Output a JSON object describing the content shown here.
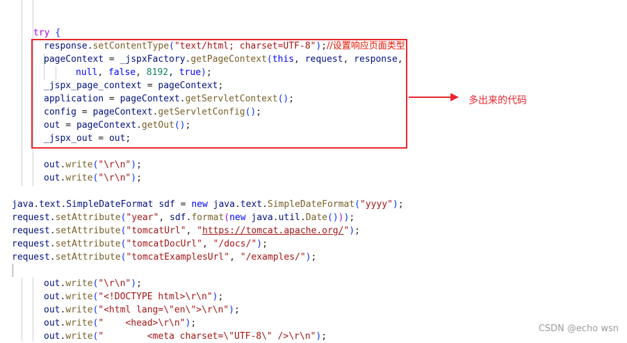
{
  "annotation": {
    "label": "多出来的代码",
    "color": "#e8262c"
  },
  "watermark": "CSDN @echo wsn",
  "theme": {
    "keyword": "#0000ff",
    "control": "#af00db",
    "variable": "#001080",
    "function": "#795e26",
    "string": "#a31515",
    "number": "#098658"
  },
  "code": {
    "lines": [
      [
        {
          "t": "try",
          "c": "ctl"
        },
        {
          "t": " ",
          "c": "plain"
        },
        {
          "t": "{",
          "c": "brk"
        }
      ],
      [
        {
          "t": "response",
          "c": "var"
        },
        {
          "t": ".",
          "c": "plain"
        },
        {
          "t": "setContentType",
          "c": "fn"
        },
        {
          "t": "(",
          "c": "brk"
        },
        {
          "t": "\"text/html; charset=UTF-8\"",
          "c": "str"
        },
        {
          "t": ")",
          "c": "brk"
        },
        {
          "t": ";",
          "c": "plain"
        },
        {
          "t": "//设置响应页面类型",
          "c": "cn"
        }
      ],
      [
        {
          "t": "pageContext",
          "c": "var"
        },
        {
          "t": " = ",
          "c": "plain"
        },
        {
          "t": "_jspxFactory",
          "c": "var"
        },
        {
          "t": ".",
          "c": "plain"
        },
        {
          "t": "getPageContext",
          "c": "fn"
        },
        {
          "t": "(",
          "c": "brk"
        },
        {
          "t": "this",
          "c": "kw"
        },
        {
          "t": ", ",
          "c": "plain"
        },
        {
          "t": "request",
          "c": "var"
        },
        {
          "t": ", ",
          "c": "plain"
        },
        {
          "t": "response",
          "c": "var"
        },
        {
          "t": ",",
          "c": "plain"
        }
      ],
      [
        {
          "t": "null",
          "c": "kw"
        },
        {
          "t": ", ",
          "c": "plain"
        },
        {
          "t": "false",
          "c": "kw"
        },
        {
          "t": ", ",
          "c": "plain"
        },
        {
          "t": "8192",
          "c": "num"
        },
        {
          "t": ", ",
          "c": "plain"
        },
        {
          "t": "true",
          "c": "kw"
        },
        {
          "t": ")",
          "c": "brk"
        },
        {
          "t": ";",
          "c": "plain"
        }
      ],
      [
        {
          "t": "_jspx_page_context",
          "c": "var"
        },
        {
          "t": " = ",
          "c": "plain"
        },
        {
          "t": "pageContext",
          "c": "var"
        },
        {
          "t": ";",
          "c": "plain"
        }
      ],
      [
        {
          "t": "application",
          "c": "var"
        },
        {
          "t": " = ",
          "c": "plain"
        },
        {
          "t": "pageContext",
          "c": "var"
        },
        {
          "t": ".",
          "c": "plain"
        },
        {
          "t": "getServletContext",
          "c": "fn"
        },
        {
          "t": "()",
          "c": "brk"
        },
        {
          "t": ";",
          "c": "plain"
        }
      ],
      [
        {
          "t": "config",
          "c": "var"
        },
        {
          "t": " = ",
          "c": "plain"
        },
        {
          "t": "pageContext",
          "c": "var"
        },
        {
          "t": ".",
          "c": "plain"
        },
        {
          "t": "getServletConfig",
          "c": "fn"
        },
        {
          "t": "()",
          "c": "brk"
        },
        {
          "t": ";",
          "c": "plain"
        }
      ],
      [
        {
          "t": "out",
          "c": "var"
        },
        {
          "t": " = ",
          "c": "plain"
        },
        {
          "t": "pageContext",
          "c": "var"
        },
        {
          "t": ".",
          "c": "plain"
        },
        {
          "t": "getOut",
          "c": "fn"
        },
        {
          "t": "()",
          "c": "brk"
        },
        {
          "t": ";",
          "c": "plain"
        }
      ],
      [
        {
          "t": "_jspx_out",
          "c": "var"
        },
        {
          "t": " = ",
          "c": "plain"
        },
        {
          "t": "out",
          "c": "var"
        },
        {
          "t": ";",
          "c": "plain"
        }
      ],
      [],
      [
        {
          "t": "out",
          "c": "var"
        },
        {
          "t": ".",
          "c": "plain"
        },
        {
          "t": "write",
          "c": "fn"
        },
        {
          "t": "(",
          "c": "brk"
        },
        {
          "t": "\"\\r\\n\"",
          "c": "str"
        },
        {
          "t": ")",
          "c": "brk"
        },
        {
          "t": ";",
          "c": "plain"
        }
      ],
      [
        {
          "t": "out",
          "c": "var"
        },
        {
          "t": ".",
          "c": "plain"
        },
        {
          "t": "write",
          "c": "fn"
        },
        {
          "t": "(",
          "c": "brk"
        },
        {
          "t": "\"\\r\\n\"",
          "c": "str"
        },
        {
          "t": ")",
          "c": "brk"
        },
        {
          "t": ";",
          "c": "plain"
        }
      ],
      [],
      [
        {
          "t": "java",
          "c": "var"
        },
        {
          "t": ".",
          "c": "plain"
        },
        {
          "t": "text",
          "c": "var"
        },
        {
          "t": ".",
          "c": "plain"
        },
        {
          "t": "SimpleDateFormat",
          "c": "var"
        },
        {
          "t": " ",
          "c": "plain"
        },
        {
          "t": "sdf",
          "c": "var"
        },
        {
          "t": " = ",
          "c": "plain"
        },
        {
          "t": "new",
          "c": "kw"
        },
        {
          "t": " ",
          "c": "plain"
        },
        {
          "t": "java",
          "c": "var"
        },
        {
          "t": ".",
          "c": "plain"
        },
        {
          "t": "text",
          "c": "var"
        },
        {
          "t": ".",
          "c": "plain"
        },
        {
          "t": "SimpleDateFormat",
          "c": "fn"
        },
        {
          "t": "(",
          "c": "brk"
        },
        {
          "t": "\"yyyy\"",
          "c": "str"
        },
        {
          "t": ")",
          "c": "brk"
        },
        {
          "t": ";",
          "c": "plain"
        }
      ],
      [
        {
          "t": "request",
          "c": "var"
        },
        {
          "t": ".",
          "c": "plain"
        },
        {
          "t": "setAttribute",
          "c": "fn"
        },
        {
          "t": "(",
          "c": "brk"
        },
        {
          "t": "\"year\"",
          "c": "str"
        },
        {
          "t": ", ",
          "c": "plain"
        },
        {
          "t": "sdf",
          "c": "var"
        },
        {
          "t": ".",
          "c": "plain"
        },
        {
          "t": "format",
          "c": "fn"
        },
        {
          "t": "(",
          "c": "ctl"
        },
        {
          "t": "new",
          "c": "kw"
        },
        {
          "t": " ",
          "c": "plain"
        },
        {
          "t": "java",
          "c": "var"
        },
        {
          "t": ".",
          "c": "plain"
        },
        {
          "t": "util",
          "c": "var"
        },
        {
          "t": ".",
          "c": "plain"
        },
        {
          "t": "Date",
          "c": "fn"
        },
        {
          "t": "()",
          "c": "brk"
        },
        {
          "t": ")",
          "c": "ctl"
        },
        {
          "t": ")",
          "c": "brk"
        },
        {
          "t": ";",
          "c": "plain"
        }
      ],
      [
        {
          "t": "request",
          "c": "var"
        },
        {
          "t": ".",
          "c": "plain"
        },
        {
          "t": "setAttribute",
          "c": "fn"
        },
        {
          "t": "(",
          "c": "brk"
        },
        {
          "t": "\"tomcatUrl\"",
          "c": "str"
        },
        {
          "t": ", ",
          "c": "plain"
        },
        {
          "t": "\"",
          "c": "str"
        },
        {
          "t": "https://tomcat.apache.org/",
          "c": "url"
        },
        {
          "t": "\"",
          "c": "str"
        },
        {
          "t": ")",
          "c": "brk"
        },
        {
          "t": ";",
          "c": "plain"
        }
      ],
      [
        {
          "t": "request",
          "c": "var"
        },
        {
          "t": ".",
          "c": "plain"
        },
        {
          "t": "setAttribute",
          "c": "fn"
        },
        {
          "t": "(",
          "c": "brk"
        },
        {
          "t": "\"tomcatDocUrl\"",
          "c": "str"
        },
        {
          "t": ", ",
          "c": "plain"
        },
        {
          "t": "\"/docs/\"",
          "c": "str"
        },
        {
          "t": ")",
          "c": "brk"
        },
        {
          "t": ";",
          "c": "plain"
        }
      ],
      [
        {
          "t": "request",
          "c": "var"
        },
        {
          "t": ".",
          "c": "plain"
        },
        {
          "t": "setAttribute",
          "c": "fn"
        },
        {
          "t": "(",
          "c": "brk"
        },
        {
          "t": "\"tomcatExamplesUrl\"",
          "c": "str"
        },
        {
          "t": ", ",
          "c": "plain"
        },
        {
          "t": "\"/examples/\"",
          "c": "str"
        },
        {
          "t": ")",
          "c": "brk"
        },
        {
          "t": ";",
          "c": "plain"
        }
      ],
      [],
      [
        {
          "t": "out",
          "c": "var"
        },
        {
          "t": ".",
          "c": "plain"
        },
        {
          "t": "write",
          "c": "fn"
        },
        {
          "t": "(",
          "c": "brk"
        },
        {
          "t": "\"\\r\\n\"",
          "c": "str"
        },
        {
          "t": ")",
          "c": "brk"
        },
        {
          "t": ";",
          "c": "plain"
        }
      ],
      [
        {
          "t": "out",
          "c": "var"
        },
        {
          "t": ".",
          "c": "plain"
        },
        {
          "t": "write",
          "c": "fn"
        },
        {
          "t": "(",
          "c": "brk"
        },
        {
          "t": "\"<!DOCTYPE html>\\r\\n\"",
          "c": "str"
        },
        {
          "t": ")",
          "c": "brk"
        },
        {
          "t": ";",
          "c": "plain"
        }
      ],
      [
        {
          "t": "out",
          "c": "var"
        },
        {
          "t": ".",
          "c": "plain"
        },
        {
          "t": "write",
          "c": "fn"
        },
        {
          "t": "(",
          "c": "brk"
        },
        {
          "t": "\"<html lang=\\\"en\\\">\\r\\n\"",
          "c": "str"
        },
        {
          "t": ")",
          "c": "brk"
        },
        {
          "t": ";",
          "c": "plain"
        }
      ],
      [
        {
          "t": "out",
          "c": "var"
        },
        {
          "t": ".",
          "c": "plain"
        },
        {
          "t": "write",
          "c": "fn"
        },
        {
          "t": "(",
          "c": "brk"
        },
        {
          "t": "\"    <head>\\r\\n\"",
          "c": "str"
        },
        {
          "t": ")",
          "c": "brk"
        },
        {
          "t": ";",
          "c": "plain"
        }
      ],
      [
        {
          "t": "out",
          "c": "var"
        },
        {
          "t": ".",
          "c": "plain"
        },
        {
          "t": "write",
          "c": "fn"
        },
        {
          "t": "(",
          "c": "brk"
        },
        {
          "t": "\"        <meta charset=\\\"UTF-8\\\" />\\r\\n\"",
          "c": "str"
        },
        {
          "t": ")",
          "c": "brk"
        },
        {
          "t": ";",
          "c": "plain"
        }
      ]
    ]
  }
}
